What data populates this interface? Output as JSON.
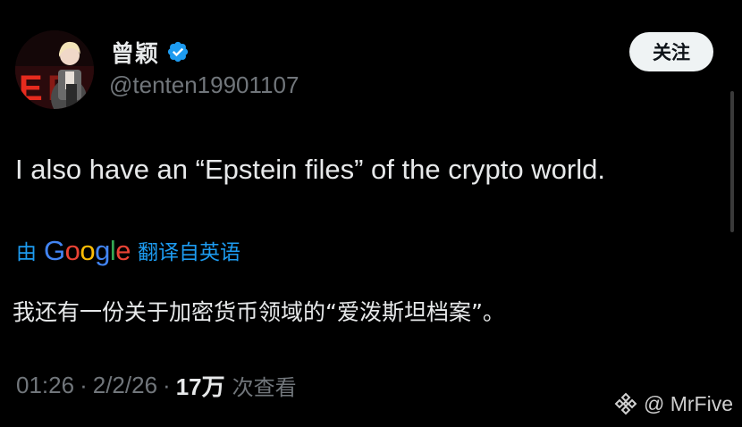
{
  "author": {
    "display_name": "曾颖",
    "handle": "@tenten19901107",
    "verified": true,
    "avatar_icon": "avatar-photo"
  },
  "actions": {
    "follow_label": "关注"
  },
  "tweet": {
    "text": "I also have an “Epstein files” of the crypto world.",
    "translation": {
      "prefix": "由",
      "provider": "Google",
      "suffix": "翻译自英语",
      "text": "我还有一份关于加密货币领域的“爱泼斯坦档案”。"
    }
  },
  "meta": {
    "time": "01:26",
    "separator": "·",
    "date": "2/2/26",
    "views_count": "17万",
    "views_label": "次查看"
  },
  "watermark": {
    "icon": "binance-icon",
    "text": "@ MrFive"
  },
  "colors": {
    "background": "#000000",
    "text_primary": "#e7e9ea",
    "text_secondary": "#71767b",
    "link_blue": "#1d9bf0",
    "verified_blue": "#1d9bf0",
    "follow_bg": "#eff3f4",
    "google_blue": "#4285f4",
    "google_red": "#ea4335",
    "google_yellow": "#fbbc05",
    "google_green": "#34a853"
  }
}
